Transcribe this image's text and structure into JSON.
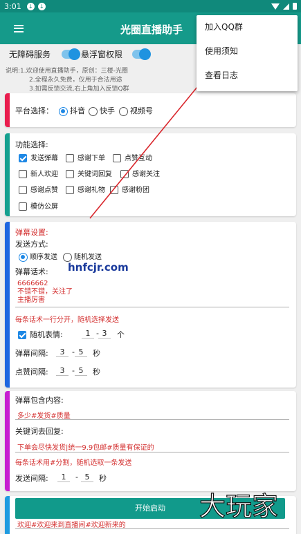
{
  "status": {
    "time": "3:01"
  },
  "appbar": {
    "title": "光圈直播助手"
  },
  "toggles": [
    {
      "label": "无障碍服务",
      "on": true
    },
    {
      "label": "悬浮窗权限",
      "on": true
    }
  ],
  "note": [
    "说明:1.欢迎使用直播助手，原创：三楼-光圈",
    "2.全程永久免费，仅用于合法用途",
    "3.如需反馈交流,右上角加入反馈Q群"
  ],
  "platform": {
    "label": "平台选择：",
    "options": [
      "抖音",
      "快手",
      "视频号"
    ],
    "selected": 0
  },
  "functions": {
    "label": "功能选择:",
    "items": [
      {
        "label": "发送弹幕",
        "checked": true
      },
      {
        "label": "感谢下单",
        "checked": false
      },
      {
        "label": "点赞互动",
        "checked": false
      },
      {
        "label": "新人欢迎",
        "checked": false
      },
      {
        "label": "关键词回复",
        "checked": false
      },
      {
        "label": "感谢关注",
        "checked": false
      },
      {
        "label": "感谢点赞",
        "checked": false
      },
      {
        "label": "感谢礼物",
        "checked": false
      },
      {
        "label": "感谢粉团",
        "checked": false
      },
      {
        "label": "模仿公屏",
        "checked": false
      }
    ]
  },
  "danmu": {
    "section_title": "弹幕设置:",
    "send_mode_label": "发送方式:",
    "modes": [
      "顺序发送",
      "随机发送"
    ],
    "mode_selected": 0,
    "words_label": "弹幕话术:",
    "words": [
      "6666662",
      "不错不错，关注了",
      "主播厉害"
    ],
    "hint": "每条话术一行分开，随机选择发送",
    "emoji_label": "随机表情:",
    "emoji_checked": true,
    "emoji_min": "1",
    "emoji_max": "3",
    "emoji_unit": "个",
    "interval_label": "弹幕间隔:",
    "interval_min": "3",
    "interval_max": "5",
    "interval_unit": "秒",
    "like_label": "点赞间隔:",
    "like_min": "3",
    "like_max": "5",
    "like_unit": "秒",
    "dash": "-"
  },
  "keyword": {
    "contains_label": "弹幕包含内容:",
    "contains_value": "多少#发货#质量",
    "reply_label": "关键词去回复:",
    "reply_value": "下单会尽快发货|统一9.9包邮#质量有保证的",
    "hint": "每条话术用#分割，随机选取一条发送",
    "interval_label": "发送间隔:",
    "interval_min": "1",
    "interval_max": "5",
    "interval_unit": "秒"
  },
  "welcome": {
    "value": "欢迎#欢迎来到直播间#欢迎新来的"
  },
  "start_button": "开始启动",
  "popup_menu": [
    "加入QQ群",
    "使用须知",
    "查看日志"
  ],
  "watermark_site": "hnfcjr.com",
  "watermark_logo": "大玩家",
  "colors": {
    "appbar": "#159a8a",
    "accent": "#1e88e5",
    "platform_bar": "#e91e4e",
    "function_bar": "#15a08f",
    "danmu_bar": "#1e66e0",
    "keyword_bar": "#c61fd0",
    "welcome_bar": "#1f9be0"
  }
}
